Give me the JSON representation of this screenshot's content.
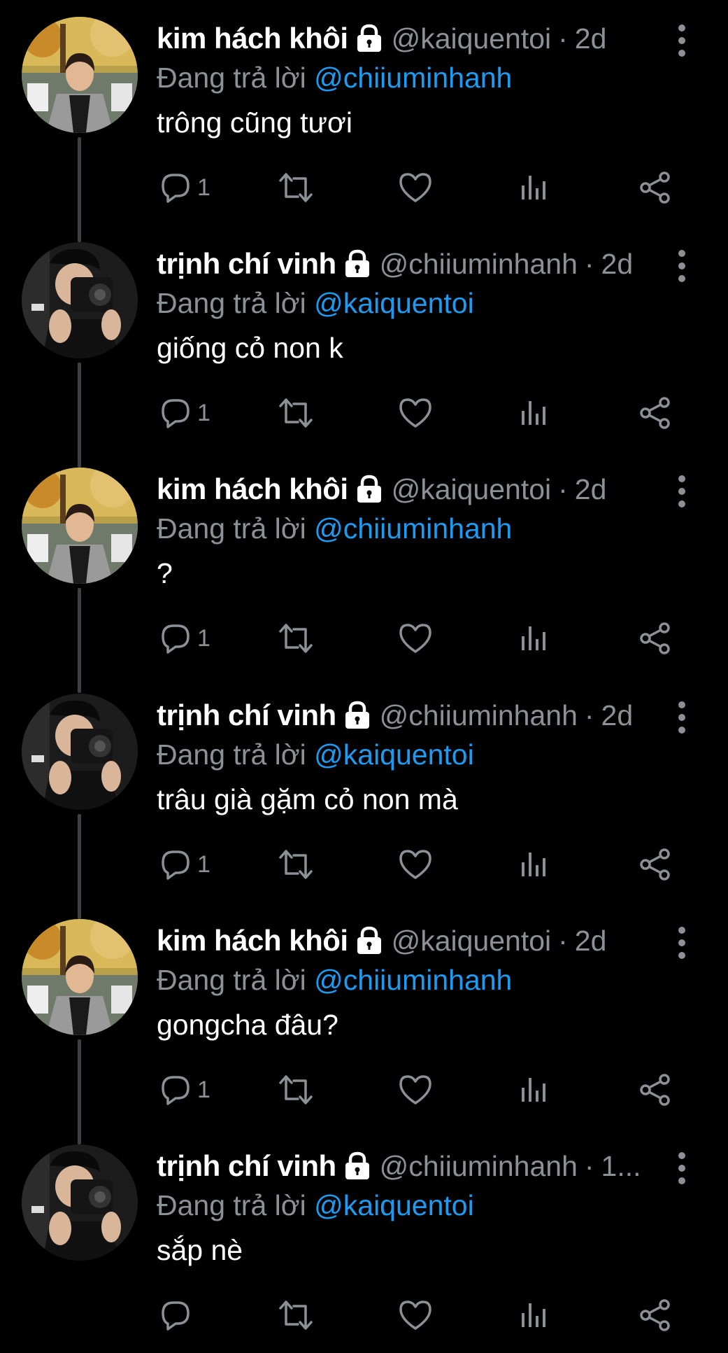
{
  "colors": {
    "background": "#000000",
    "name": "#ffffff",
    "secondary_text": "#8b9197",
    "mention": "#1d9bf0",
    "thread_line": "#3e4144"
  },
  "icons": {
    "lock": "lock-icon",
    "more": "more-vertical-icon",
    "reply": "reply-icon",
    "retweet": "retweet-icon",
    "like": "heart-icon",
    "views": "views-icon",
    "share": "share-icon"
  },
  "tweets": [
    {
      "name": "kim hách khôi",
      "handle": "@kaiquentoi",
      "time": "2d",
      "reply_prefix": "Đang trả lời ",
      "reply_to": "@chiiuminhanh",
      "text": "trông cũng tươi",
      "reply_count": "1"
    },
    {
      "name": "trịnh chí vinh",
      "handle": "@chiiuminhanh",
      "time": "2d",
      "reply_prefix": "Đang trả lời ",
      "reply_to": "@kaiquentoi",
      "text": "giống cỏ non k",
      "reply_count": "1"
    },
    {
      "name": "kim hách khôi",
      "handle": "@kaiquentoi",
      "time": "2d",
      "reply_prefix": "Đang trả lời ",
      "reply_to": "@chiiuminhanh",
      "text": "?",
      "reply_count": "1"
    },
    {
      "name": "trịnh chí vinh",
      "handle": "@chiiuminhanh",
      "time": "2d",
      "reply_prefix": "Đang trả lời ",
      "reply_to": "@kaiquentoi",
      "text": "trâu già gặm cỏ non mà",
      "reply_count": "1"
    },
    {
      "name": "kim hách khôi",
      "handle": "@kaiquentoi",
      "time": "2d",
      "reply_prefix": "Đang trả lời ",
      "reply_to": "@chiiuminhanh",
      "text": "gongcha đâu?",
      "reply_count": "1"
    },
    {
      "name": "trịnh chí vinh",
      "handle": "@chiiuminhanh",
      "time": "1...",
      "reply_prefix": "Đang trả lời ",
      "reply_to": "@kaiquentoi",
      "text": "sắp nè",
      "reply_count": ""
    }
  ]
}
